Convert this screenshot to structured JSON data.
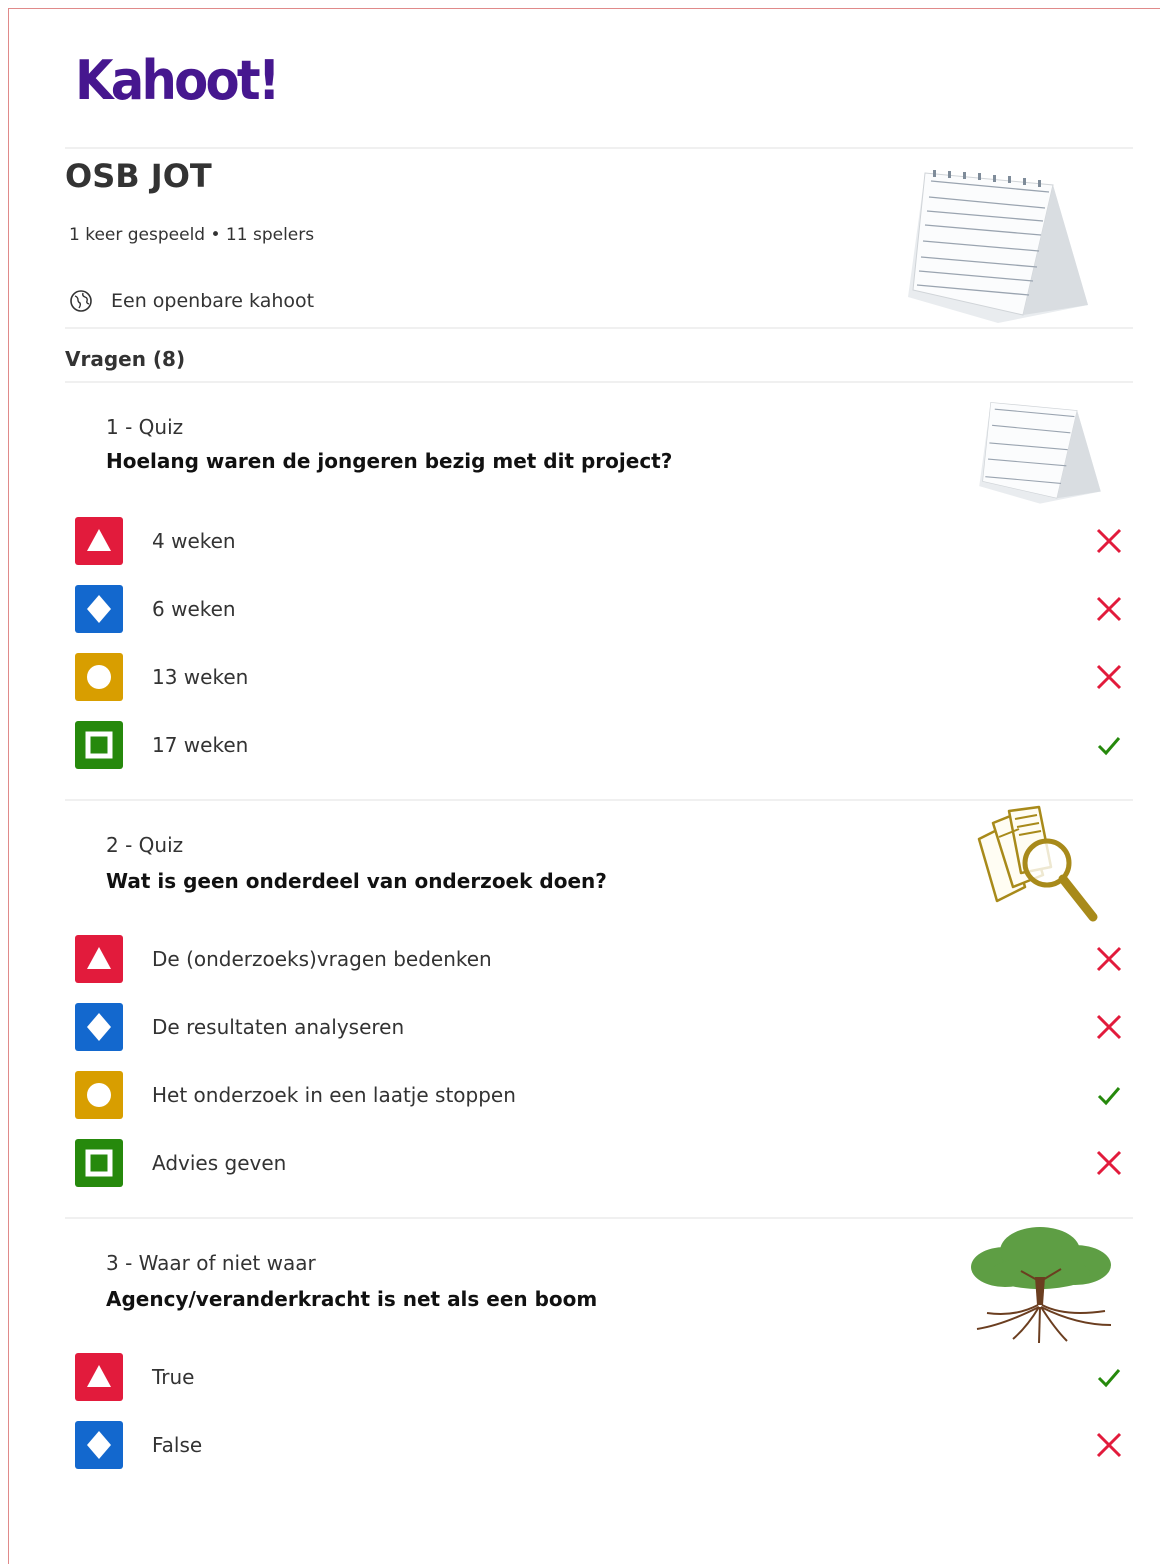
{
  "brand": {
    "logo_text": "Kahoot!",
    "logo_color": "#46178f"
  },
  "kahoot": {
    "title": "OSB JOT",
    "meta": "1 keer gespeeld • 11 spelers",
    "visibility": "Een openbare kahoot",
    "cover_icon": "desk-calendar-image"
  },
  "questions_header": "Vragen (8)",
  "colors": {
    "red": "#e21b3c",
    "blue": "#1368ce",
    "yellow": "#d89e00",
    "green": "#26890c",
    "correct": "#26890c",
    "wrong": "#e21b3c"
  },
  "questions": [
    {
      "type": "1 - Quiz",
      "text": "Hoelang waren de jongeren bezig met dit project?",
      "image_icon": "desk-calendar-image",
      "answers": [
        {
          "text": "4 weken",
          "shape": "triangle",
          "correct": false
        },
        {
          "text": "6 weken",
          "shape": "diamond",
          "correct": false
        },
        {
          "text": "13 weken",
          "shape": "circle",
          "correct": false
        },
        {
          "text": "17 weken",
          "shape": "square",
          "correct": true
        }
      ]
    },
    {
      "type": "2 - Quiz",
      "text": "Wat is geen onderdeel van onderzoek doen?",
      "image_icon": "documents-magnifier-image",
      "answers": [
        {
          "text": "De (onderzoeks)vragen bedenken",
          "shape": "triangle",
          "correct": false
        },
        {
          "text": "De resultaten analyseren",
          "shape": "diamond",
          "correct": false
        },
        {
          "text": "Het onderzoek in een laatje stoppen",
          "shape": "circle",
          "correct": true
        },
        {
          "text": "Advies geven",
          "shape": "square",
          "correct": false
        }
      ]
    },
    {
      "type": "3 - Waar of niet waar",
      "text": "Agency/veranderkracht is net als een boom",
      "image_icon": "tree-with-roots-image",
      "answers": [
        {
          "text": "True",
          "shape": "triangle",
          "correct": true
        },
        {
          "text": "False",
          "shape": "diamond",
          "correct": false
        }
      ]
    }
  ]
}
